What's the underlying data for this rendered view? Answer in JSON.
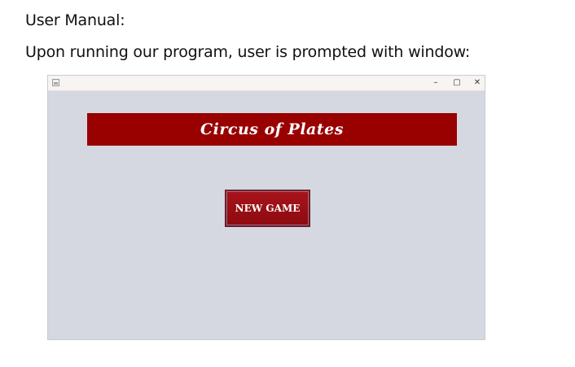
{
  "document": {
    "heading": "User Manual:",
    "paragraph": "Upon running our program, user is prompted with window:"
  },
  "window": {
    "title": "",
    "controls": {
      "minimize": "–",
      "maximize": "▢",
      "close": "✕"
    },
    "banner_title": "Circus of Plates",
    "new_game_label": "NEW GAME"
  },
  "colors": {
    "banner": "#990000",
    "button": "#a0141a",
    "window_background": "#d6d8e1"
  },
  "icons": [
    "app-icon",
    "minimize-icon",
    "maximize-icon",
    "close-icon"
  ]
}
